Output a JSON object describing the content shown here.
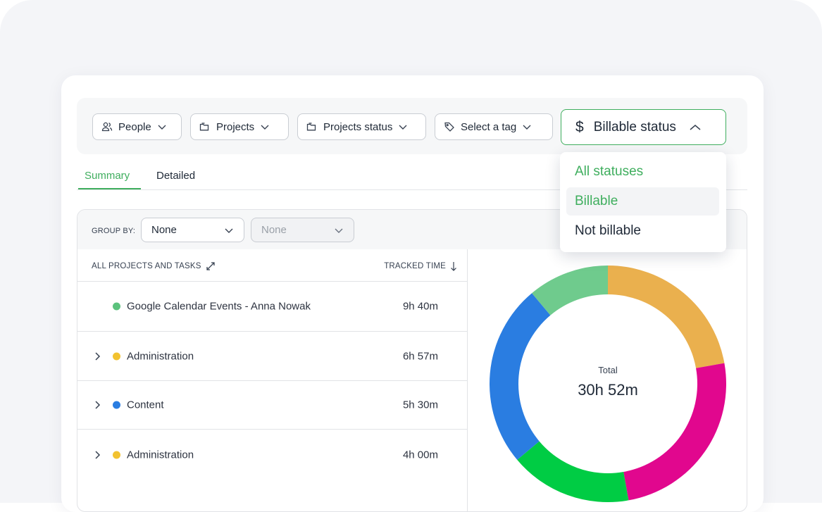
{
  "filters": {
    "people": "People",
    "projects": "Projects",
    "projects_status": "Projects status",
    "tag": "Select a tag",
    "billable": "Billable status"
  },
  "tabs": {
    "summary": "Summary",
    "detailed": "Detailed"
  },
  "group_by": {
    "label": "GROUP BY:",
    "primary": "None",
    "secondary": "None"
  },
  "table": {
    "col_projects": "ALL PROJECTS AND TASKS",
    "col_time": "TRACKED TIME",
    "rows": [
      {
        "name": "Google Calendar Events - Anna Nowak",
        "time": "9h 40m",
        "color": "#5cc27d",
        "expandable": false
      },
      {
        "name": "Administration",
        "time": "6h 57m",
        "color": "#f2c230",
        "expandable": true
      },
      {
        "name": "Content",
        "time": "5h 30m",
        "color": "#2a7de1",
        "expandable": true
      },
      {
        "name": "Administration",
        "time": "4h 00m",
        "color": "#f2c230",
        "expandable": true
      }
    ]
  },
  "summary": {
    "total_label": "Total",
    "total_value": "30h 52m"
  },
  "donut_segments": [
    {
      "color": "#eab04e",
      "fraction": 0.222
    },
    {
      "color": "#e1078e",
      "fraction": 0.25
    },
    {
      "color": "#00cc44",
      "fraction": 0.167
    },
    {
      "color": "#2a7de1",
      "fraction": 0.25
    },
    {
      "color": "#6fcb8d",
      "fraction": 0.111
    }
  ],
  "dropdown": {
    "options": [
      "All statuses",
      "Billable",
      "Not billable"
    ]
  },
  "colors": {
    "accent": "#3fae5e"
  }
}
